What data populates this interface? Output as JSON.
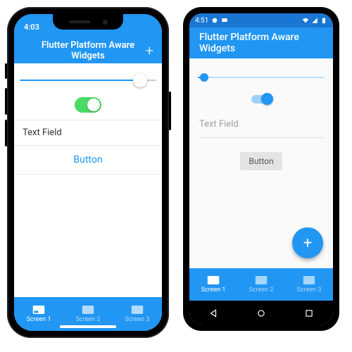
{
  "ios": {
    "status": {
      "time": "4:03"
    },
    "nav": {
      "title": "Flutter Platform Aware Widgets",
      "action_icon": "plus-icon"
    },
    "slider": {
      "value": 0.88
    },
    "switch": {
      "on": true
    },
    "textfield": {
      "placeholder": "Text Field"
    },
    "button": {
      "label": "Button"
    },
    "tabs": [
      {
        "label": "Screen 1",
        "icon": "tab-icon",
        "active": true
      },
      {
        "label": "Screen 2",
        "icon": "tab-icon",
        "active": false
      },
      {
        "label": "Screen 3",
        "icon": "tab-icon",
        "active": false
      }
    ]
  },
  "android": {
    "status": {
      "time": "4:51"
    },
    "appbar": {
      "title": "Flutter Platform Aware Widgets"
    },
    "slider": {
      "value": 0.05
    },
    "switch": {
      "on": true
    },
    "textfield": {
      "placeholder": "Text Field"
    },
    "button": {
      "label": "Button"
    },
    "fab": {
      "icon": "plus-icon"
    },
    "tabs": [
      {
        "label": "Screen 1",
        "icon": "tab-icon",
        "active": true
      },
      {
        "label": "Screen 2",
        "icon": "tab-icon",
        "active": false
      },
      {
        "label": "Screen 3",
        "icon": "tab-icon",
        "active": false
      }
    ]
  },
  "colors": {
    "primary": "#2196F3",
    "primaryDark": "#1976D2",
    "iosSwitchOn": "#4CD964"
  }
}
